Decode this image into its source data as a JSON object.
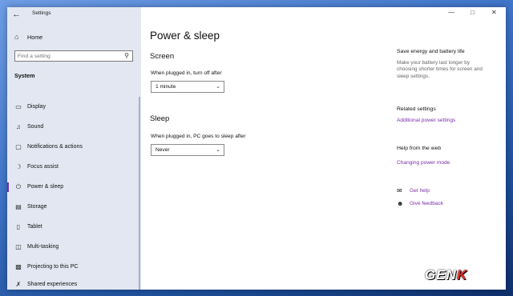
{
  "app": {
    "title": "Settings"
  },
  "sidebar": {
    "home_label": "Home",
    "search_placeholder": "Find a setting",
    "section_title": "System",
    "items": [
      {
        "label": "Display",
        "icon": "display-icon"
      },
      {
        "label": "Sound",
        "icon": "sound-icon"
      },
      {
        "label": "Notifications & actions",
        "icon": "notifications-icon"
      },
      {
        "label": "Focus assist",
        "icon": "focus-assist-icon"
      },
      {
        "label": "Power & sleep",
        "icon": "power-icon",
        "selected": true
      },
      {
        "label": "Storage",
        "icon": "storage-icon"
      },
      {
        "label": "Tablet",
        "icon": "tablet-icon"
      },
      {
        "label": "Multi-tasking",
        "icon": "multitasking-icon"
      },
      {
        "label": "Projecting to this PC",
        "icon": "projecting-icon"
      },
      {
        "label": "Shared experiences",
        "icon": "shared-experiences-icon"
      }
    ]
  },
  "main": {
    "title": "Power & sleep",
    "screen": {
      "heading": "Screen",
      "label": "When plugged in, turn off after",
      "value": "1 minute"
    },
    "sleep": {
      "heading": "Sleep",
      "label": "When plugged in, PC goes to sleep after",
      "value": "Never"
    }
  },
  "right": {
    "save_title": "Save energy and battery life",
    "save_desc": "Make your battery last longer by choosing shorter times for screen and sleep settings.",
    "related_title": "Related settings",
    "related_link": "Additional power settings",
    "help_title": "Help from the web",
    "help_link": "Changing power mode",
    "get_help": "Get help",
    "give_feedback": "Give feedback"
  },
  "watermark": {
    "part1": "GEN",
    "part2": "K"
  },
  "colors": {
    "accent": "#7a2fa8",
    "sidebar_bg": "#e2e7f1",
    "selection_bar": "#6b2fa5"
  }
}
